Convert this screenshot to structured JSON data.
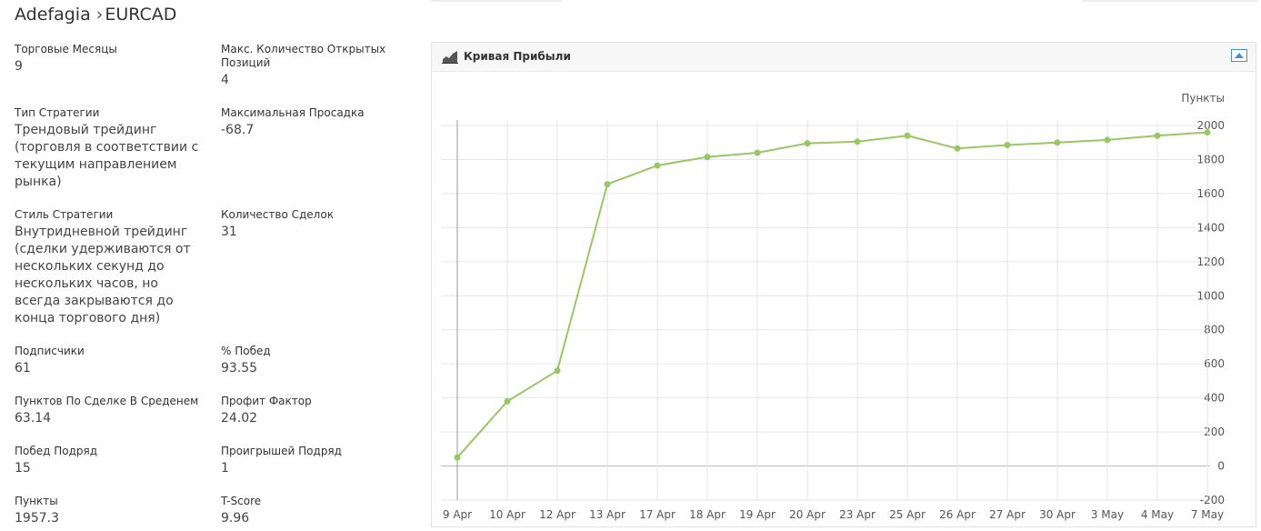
{
  "header": {
    "name": "Adefagia",
    "separator": "›",
    "symbol": "EURCAD"
  },
  "stats": [
    {
      "label": "Торговые Месяцы",
      "value": "9"
    },
    {
      "label": "Макс. Количество Открытых Позиций",
      "value": "4"
    },
    {
      "label": "Тип Стратегии",
      "value": "Трендовый трейдинг (торговля в соответствии с текущим направлением рынка)"
    },
    {
      "label": "Максимальная Просадка",
      "value": "-68.7"
    },
    {
      "label": "Стиль Стратегии",
      "value": "Внутридневной трейдинг (сделки удерживаются от нескольких секунд до нескольких часов, но всегда закрываются до конца торгового дня)"
    },
    {
      "label": "Количество Сделок",
      "value": "31"
    },
    {
      "label": "Подписчики",
      "value": "61"
    },
    {
      "label": "% Побед",
      "value": "93.55"
    },
    {
      "label": "Пунктов По Сделке В Среденем",
      "value": "63.14"
    },
    {
      "label": "Профит Фактор",
      "value": "24.02"
    },
    {
      "label": "Побед Подряд",
      "value": "15"
    },
    {
      "label": "Проигрышей Подряд",
      "value": "1"
    },
    {
      "label": "Пункты",
      "value": "1957.3"
    },
    {
      "label": "T-Score",
      "value": "9.96"
    }
  ],
  "panel": {
    "title": "Кривая Прибыли",
    "icon": "area-chart-icon",
    "collapse_icon": "collapse-icon"
  },
  "colors": {
    "line": "#99c766",
    "grid": "#e6e6e6",
    "zero": "#bbbbbb",
    "axis_text": "#555555"
  },
  "chart_data": {
    "type": "line",
    "title": "Кривая Прибыли",
    "ylabel": "Пункты",
    "categories": [
      "9 Apr",
      "10 Apr",
      "12 Apr",
      "13 Apr",
      "17 Apr",
      "18 Apr",
      "19 Apr",
      "20 Apr",
      "23 Apr",
      "25 Apr",
      "26 Apr",
      "27 Apr",
      "30 Apr",
      "3 May",
      "4 May",
      "7 May"
    ],
    "values": [
      50,
      380,
      560,
      1655,
      1765,
      1815,
      1840,
      1895,
      1905,
      1940,
      1865,
      1885,
      1900,
      1915,
      1940,
      1960
    ],
    "ylim": [
      -200,
      2000
    ],
    "yticks": [
      -200,
      0,
      200,
      400,
      600,
      800,
      1000,
      1200,
      1400,
      1600,
      1800,
      2000
    ],
    "grid": true,
    "y_axis_side": "right",
    "legend": "none"
  }
}
